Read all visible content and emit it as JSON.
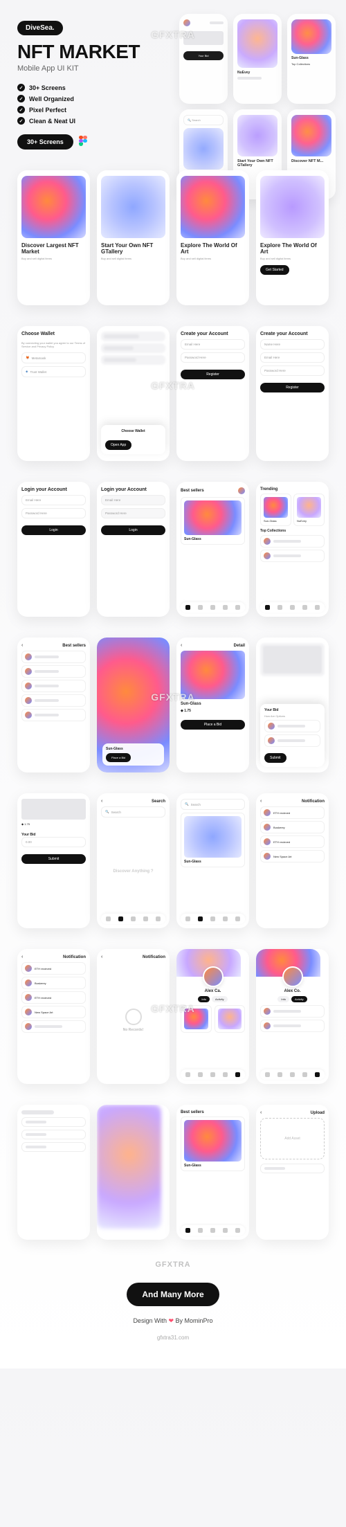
{
  "brand": "DiveSea.",
  "title": "NFT MARKET",
  "subtitle": "Mobile App UI KIT",
  "features": [
    "30+ Screens",
    "Well Organized",
    "Pixel Perfect",
    "Clean & Neat UI"
  ],
  "screens_pill": "30+ Screens",
  "watermark": "GFXTRA",
  "onboard": [
    {
      "title": "Discover Largest NFT Market",
      "sub": "Buy and sell digital items"
    },
    {
      "title": "Start Your Own NFT GTallery",
      "sub": "Buy and sell digital items"
    },
    {
      "title": "Explore The World Of Art",
      "sub": "Buy and sell digital items"
    },
    {
      "title": "Explore The World Of Art",
      "sub": "Buy and sell digital items",
      "btn": "Get Started"
    }
  ],
  "wallet": {
    "title": "Choose Wallet",
    "sub": "By connecting your wallet you agree to our Terms of Service and Privacy Policy",
    "opts": [
      "Metamask",
      "Trust Wallet"
    ],
    "modal_title": "Choose Wallet",
    "modal_btn": "Open App"
  },
  "create": {
    "title": "Create your Account",
    "email": "Email Here",
    "pass": "Password Here",
    "btn": "Register",
    "name": "Name Here"
  },
  "login": {
    "title": "Login your Account",
    "email": "Email Here",
    "pass": "Password Here",
    "btn": "Login"
  },
  "sellers": {
    "title": "Best sellers",
    "card_name": "Sun-Glass",
    "trending": "Trending",
    "top": "Top Collections",
    "names": [
      "Sun-Glass",
      "NuEvey"
    ]
  },
  "detail": {
    "back": "Detail",
    "name": "Sun-Glass",
    "price": "1.75",
    "btn": "Place a Bid",
    "bid_title": "Your Bid",
    "bid_q": "How Are Options"
  },
  "search": {
    "title": "Search",
    "placeholder": "Search",
    "discover": "Discover Anything ?",
    "card_name": "Sun-Glass"
  },
  "notif": {
    "title": "Notification",
    "empty": "No Records!",
    "items": [
      "ETH recieved",
      "Buskerey",
      "ETH recieved",
      "New Space Art"
    ]
  },
  "profile": {
    "name1": "Alex Ca.",
    "name2": "Alex Co.",
    "tabs": [
      "Info",
      "Activity"
    ]
  },
  "upload": {
    "title": "Upload",
    "box": "Add Asset"
  },
  "footer": {
    "more": "And Many More",
    "credit_pre": "Design With",
    "credit_post": "By MominPro"
  },
  "link": "gfxtra31.com"
}
